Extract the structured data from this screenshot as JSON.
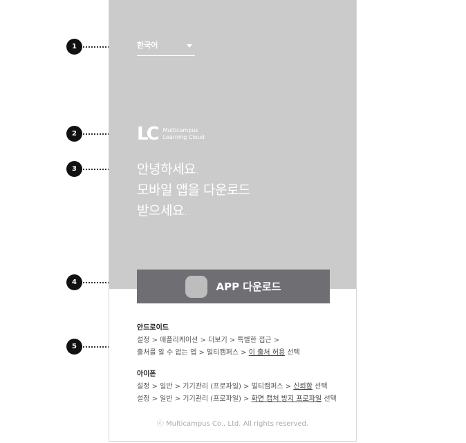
{
  "language": {
    "label": "한국어"
  },
  "logo": {
    "mark": "LC",
    "line1": "Multicampus",
    "line2": "Learning Cloud"
  },
  "greeting": {
    "line1": "안녕하세요.",
    "line2": "모바일 앱을 다운로드",
    "line3": "받으세요."
  },
  "app_button": {
    "label": "APP 다운로드"
  },
  "guide": {
    "android": {
      "title": "안드로이드",
      "line1": "설정 > 애플리케이션 > 더보기 > 특별한 접근 >",
      "line2_prefix": "출처를 알 수 없는 앱 > 멀티캠퍼스 > ",
      "line2_link": "이 출처 허용",
      "line2_suffix": " 선택"
    },
    "iphone": {
      "title": "아이폰",
      "line1_prefix": "설정 > 일반 > 기기관리 (프로파일) > 멀티캠퍼스 > ",
      "line1_link": "신뢰함",
      "line1_suffix": " 선택",
      "line2_prefix": "설정 > 일반 > 기기관리 (프로파일) > ",
      "line2_link": "화면 캡처 방지 프로파일",
      "line2_suffix": " 선택"
    }
  },
  "copyright": "ⓒ Multicampus Co., Ltd. All rights reserved.",
  "callouts": [
    "1",
    "2",
    "3",
    "4",
    "5"
  ]
}
